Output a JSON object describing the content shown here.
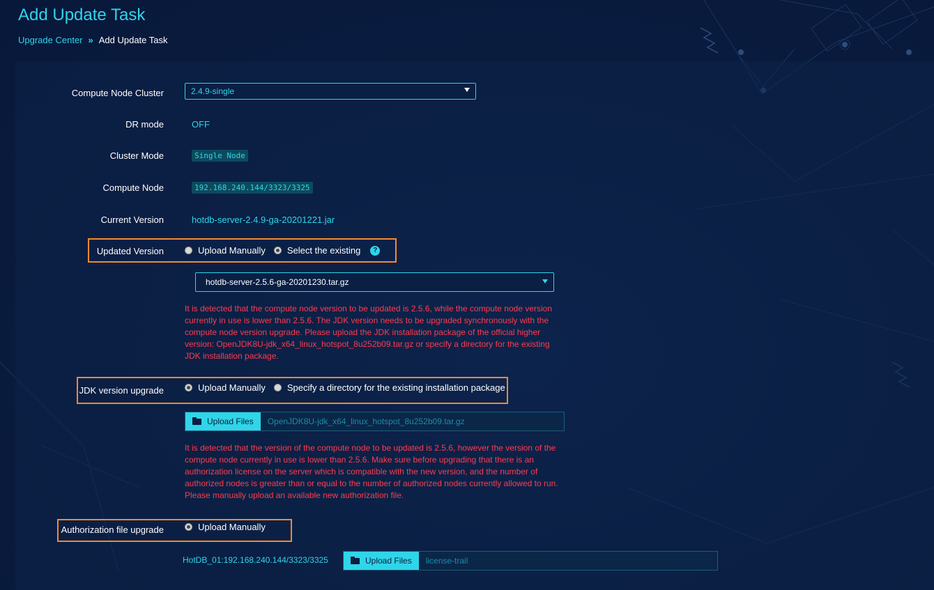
{
  "header": {
    "title": "Add Update Task",
    "breadcrumb": {
      "parent": "Upgrade Center",
      "separator": "»",
      "current": "Add Update Task"
    }
  },
  "colors": {
    "accent": "#2fd5e8",
    "warning": "#ff3b4e",
    "highlight": "#f28a30",
    "background": "#0a1d40"
  },
  "form": {
    "cluster": {
      "label": "Compute Node Cluster",
      "value": "2.4.9-single"
    },
    "dr_mode": {
      "label": "DR mode",
      "value": "OFF"
    },
    "cluster_mode": {
      "label": "Cluster Mode",
      "value": "Single Node"
    },
    "compute_node": {
      "label": "Compute Node",
      "value": "192.168.240.144/3323/3325"
    },
    "current_version": {
      "label": "Current Version",
      "value": "hotdb-server-2.4.9-ga-20201221.jar"
    },
    "updated_version": {
      "label": "Updated Version",
      "options": [
        "Upload Manually",
        "Select the existing"
      ],
      "selected": "Select the existing",
      "help_icon": "question-icon",
      "select_value": "hotdb-server-2.5.6-ga-20201230.tar.gz",
      "warning": "It is detected that the compute node version to be updated is 2.5.6, while the compute node version currently in use is lower than 2.5.6. The JDK version needs to be upgraded synchronously with the compute node version upgrade. Please upload the JDK installation package of the official higher version: OpenJDK8U-jdk_x64_linux_hotspot_8u252b09.tar.gz or specify a directory for the existing JDK installation package."
    },
    "jdk_upgrade": {
      "label": "JDK version upgrade",
      "options": [
        "Upload Manually",
        "Specify a directory for the existing installation package"
      ],
      "selected": "Upload Manually",
      "upload_label": "Upload Files",
      "file_name": "OpenJDK8U-jdk_x64_linux_hotspot_8u252b09.tar.gz",
      "warning": "It is detected that the version of the compute node to be updated is 2.5.6, however the version of the compute node currently in use is lower than 2.5.6. Make sure before upgrading that there is an authorization license on the server which is compatible with the new version, and the number of authorized nodes is greater than or equal to the number of authorized nodes currently allowed to run. Please manually upload an available new authorization file."
    },
    "auth_upgrade": {
      "label": "Authorization file upgrade",
      "options": [
        "Upload Manually"
      ],
      "selected": "Upload Manually",
      "node_label": "HotDB_01:192.168.240.144/3323/3325",
      "upload_label": "Upload Files",
      "file_name": "license-trail"
    }
  }
}
